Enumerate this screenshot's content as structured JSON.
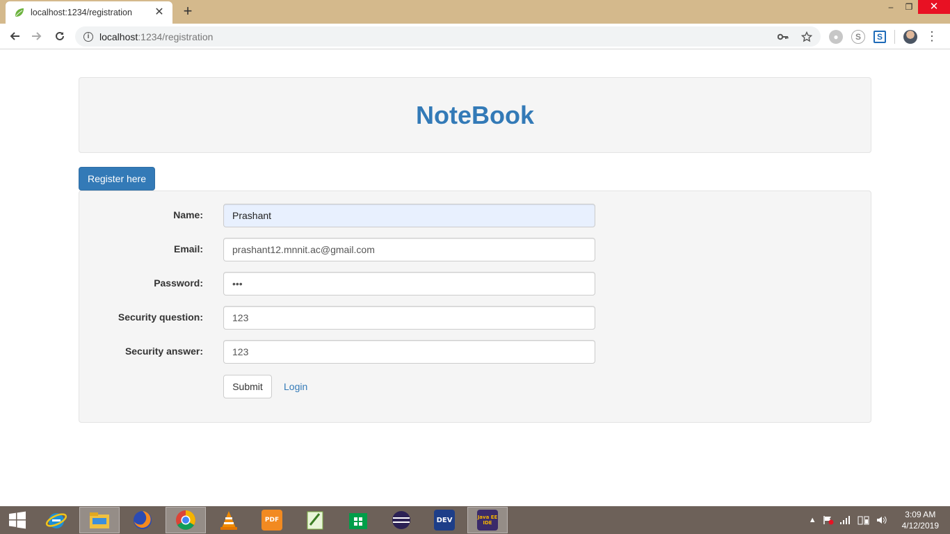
{
  "browser": {
    "tab_title": "localhost:1234/registration",
    "tab_close": "✕",
    "new_tab": "+",
    "url_host": "localhost",
    "url_rest": ":1234/registration",
    "win_minimize": "–",
    "win_restore": "❐",
    "win_close": "✕"
  },
  "header": {
    "brand": "NoteBook"
  },
  "form": {
    "heading_button": "Register here",
    "fields": [
      {
        "label": "Name:",
        "value": "Prashant"
      },
      {
        "label": "Email:",
        "value": "prashant12.mnnit.ac@gmail.com"
      },
      {
        "label": "Password:",
        "value": "•••"
      },
      {
        "label": "Security question:",
        "value": "123"
      },
      {
        "label": "Security answer:",
        "value": "123"
      }
    ],
    "submit_label": "Submit",
    "login_label": "Login"
  },
  "taskbar": {
    "apps": [
      "internet-explorer",
      "file-explorer",
      "firefox",
      "chrome",
      "vlc",
      "foxit-pdf",
      "notepad-plus-plus",
      "windows-store",
      "eclipse",
      "dev-cpp",
      "java-ee-ide"
    ],
    "pdf_label": "PDF",
    "dev_label": "DEV",
    "javaee_label": "Java EE IDE",
    "time": "3:09 AM",
    "date": "4/12/2019"
  },
  "colors": {
    "primary": "#337ab7",
    "tabstrip": "#d4b98c",
    "taskbar": "#6d6159",
    "panel": "#f5f5f5"
  }
}
